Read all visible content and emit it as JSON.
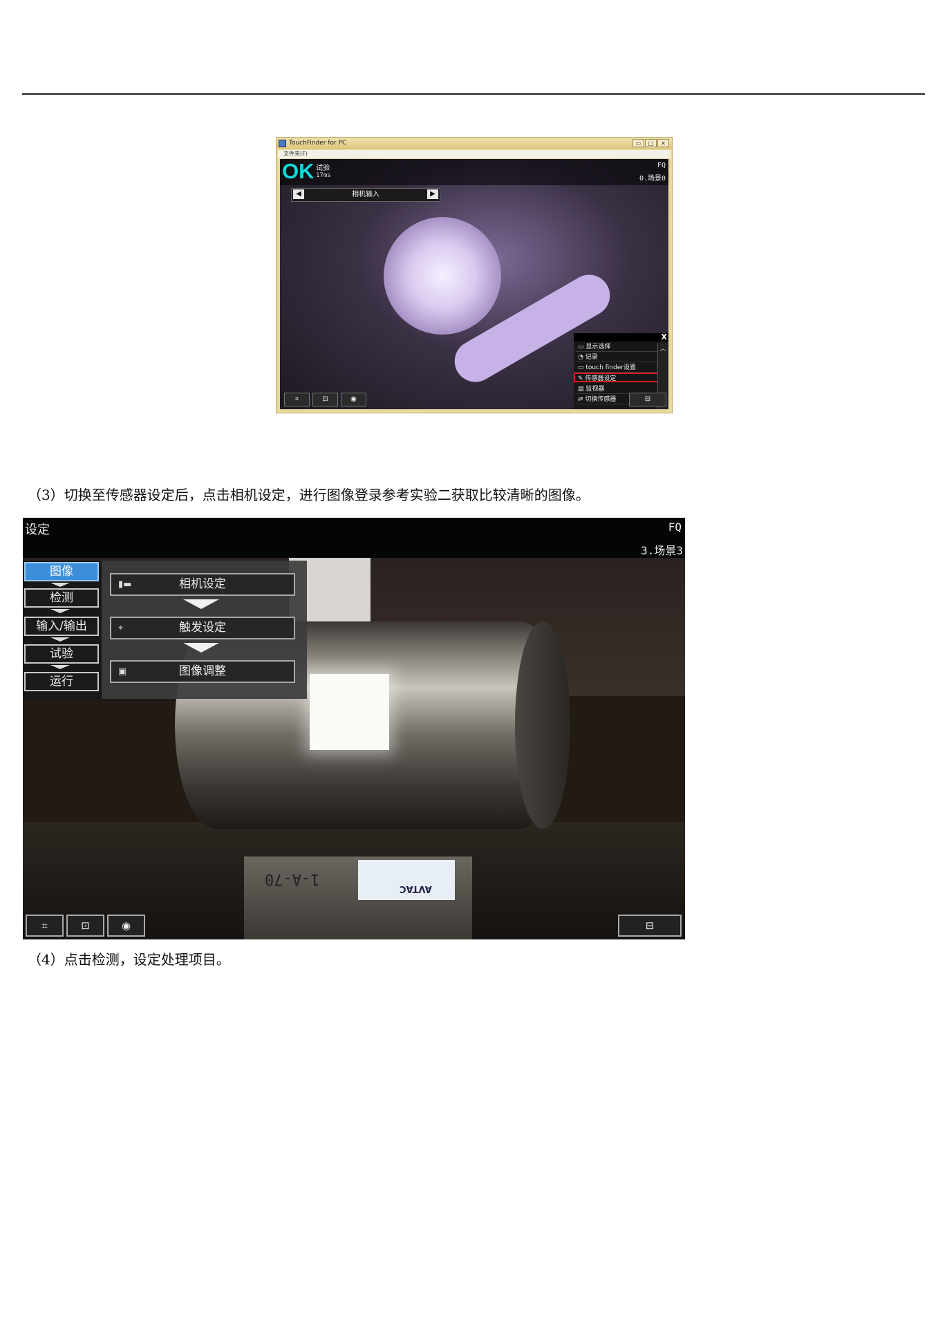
{
  "window": {
    "title": "TouchFinder for PC",
    "menu": "文件夹(F)",
    "controls": [
      "▭",
      "□",
      "✕"
    ]
  },
  "screen1": {
    "judgement": "OK",
    "mode": "试验",
    "time": "17ms",
    "sensor": "FQ",
    "scene": "0.场景0",
    "nav_label": "相机输入",
    "nav_left": "◀",
    "nav_right": "▶",
    "close": "X",
    "menu_items": [
      {
        "label": "显示选择",
        "icon": "display-icon"
      },
      {
        "label": "记录",
        "icon": "record-icon"
      },
      {
        "label": "touch finder设置",
        "icon": "monitor-icon"
      },
      {
        "label": "传感器设定",
        "icon": "wrench-icon",
        "selected": true
      },
      {
        "label": "监视器",
        "icon": "monitor-icon"
      },
      {
        "label": "切换传感器",
        "icon": "switch-icon"
      }
    ],
    "scroll_up": "︿",
    "scroll_down": "﹀",
    "bottom_buttons": [
      "⌗",
      "⊡",
      "◉"
    ],
    "tool_button": "⊟",
    "highlight_color": "#e01818"
  },
  "caption3": "（3）切换至传感器设定后，点击相机设定，进行图像登录参考实验二获取比较清晰的图像。",
  "screen2": {
    "title": "设定",
    "sensor": "FQ",
    "scene": "3.场景3",
    "tabs": [
      {
        "label": "图像",
        "active": true
      },
      {
        "label": "检测",
        "active": false
      },
      {
        "label": "输入/输出",
        "active": false
      },
      {
        "label": "试验",
        "active": false
      },
      {
        "label": "运行",
        "active": false
      }
    ],
    "items": [
      {
        "label": "相机设定",
        "icon": "camera-setting-icon",
        "glyph": "▮▬"
      },
      {
        "label": "触发设定",
        "icon": "trigger-icon",
        "glyph": "⌖"
      },
      {
        "label": "图像调整",
        "icon": "image-adjust-icon",
        "glyph": "▣"
      }
    ],
    "bottom_buttons": [
      "⌗",
      "⊡",
      "◉"
    ],
    "tool_button": "⊟",
    "photo_text_1": "1-A-70",
    "photo_text_2": "AVTAC",
    "accent": "#3c8ed8"
  },
  "caption4": "（4）点击检测，设定处理项目。"
}
